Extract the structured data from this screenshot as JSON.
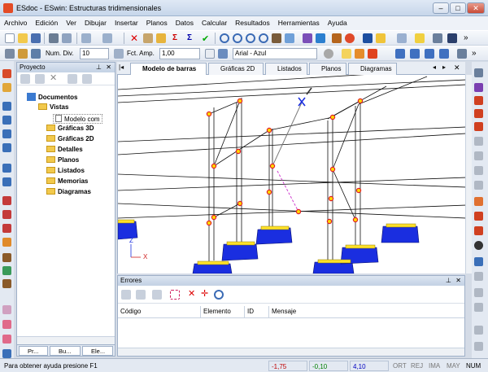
{
  "window": {
    "title": "ESdoc - ESwin: Estructuras tridimensionales"
  },
  "menu": [
    "Archivo",
    "Edición",
    "Ver",
    "Dibujar",
    "Insertar",
    "Planos",
    "Datos",
    "Calcular",
    "Resultados",
    "Herramientas",
    "Ayuda"
  ],
  "toolbar2": {
    "div_label": "Num. Div.",
    "div_value": "10",
    "amp_label": "Fct. Amp.",
    "amp_value": "1,00",
    "font_value": "Arial - Azul"
  },
  "project": {
    "title": "Proyecto",
    "tree": [
      {
        "label": "Documentos",
        "bold": true
      },
      {
        "label": "Vistas",
        "bold": true
      },
      {
        "label": "Modelo com",
        "bold": false
      },
      {
        "label": "Gráficas 3D",
        "bold": true
      },
      {
        "label": "Gráficas 2D",
        "bold": true
      },
      {
        "label": "Detalles",
        "bold": true
      },
      {
        "label": "Planos",
        "bold": true
      },
      {
        "label": "Listados",
        "bold": true
      },
      {
        "label": "Memorias",
        "bold": true
      },
      {
        "label": "Diagramas",
        "bold": true
      }
    ],
    "bottom_tabs": [
      "Pr...",
      "Bu...",
      "Ele..."
    ]
  },
  "doc_tabs": [
    "Modelo de barras",
    "Gráficas 2D",
    "Listados",
    "Planos",
    "Diagramas"
  ],
  "axis": {
    "z": "Z",
    "x": "X"
  },
  "errors": {
    "title": "Errores",
    "columns": [
      "Código",
      "Elemento",
      "ID",
      "Mensaje"
    ]
  },
  "status": {
    "help": "Para obtener ayuda presione F1",
    "v1": "-1,75",
    "v2": "-0,10",
    "v3": "4,10",
    "flags": [
      "ORT",
      "REJ",
      "IMA",
      "MAY",
      "NUM"
    ],
    "colors": {
      "red": "#c00000",
      "green": "#008000",
      "blue": "#0000c0"
    }
  }
}
